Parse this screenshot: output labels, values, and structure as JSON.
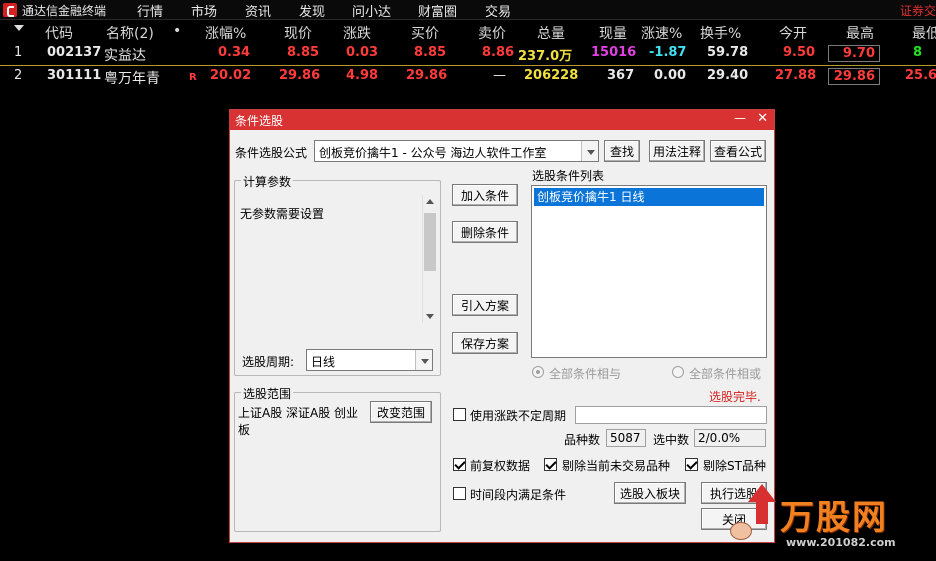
{
  "menubar": {
    "app_name": "通达信金融终端",
    "items": [
      "行情",
      "市场",
      "资讯",
      "发现",
      "问小达",
      "财富圈",
      "交易"
    ],
    "right_tag": "证券交"
  },
  "quote_table": {
    "headers": [
      "代码",
      "名称(2)",
      "涨幅%",
      "现价",
      "涨跌",
      "买价",
      "卖价",
      "总量",
      "现量",
      "涨速%",
      "换手%",
      "今开",
      "最高",
      "最低"
    ],
    "dot": "•",
    "rows": [
      {
        "idx": "1",
        "code": "002137",
        "name": "实益达",
        "flag": "",
        "pct": "0.34",
        "price": "8.85",
        "change": "0.03",
        "bid": "8.85",
        "ask": "8.86",
        "volume": "237.0万",
        "cur_vol": "15016",
        "speed": "-1.87",
        "turnover": "59.78",
        "open": "9.50",
        "high": "9.70",
        "low": "8"
      },
      {
        "idx": "2",
        "code": "301111",
        "name": "粤万年青",
        "flag": "R",
        "pct": "20.02",
        "price": "29.86",
        "change": "4.98",
        "bid": "29.86",
        "ask": "—",
        "volume": "206228",
        "cur_vol": "367",
        "speed": "0.00",
        "turnover": "29.40",
        "open": "27.88",
        "high": "29.86",
        "low": "25.6"
      }
    ]
  },
  "dialog": {
    "title": "条件选股",
    "min_glyph": "—",
    "close_glyph": "✕",
    "formula_label": "条件选股公式",
    "formula_value": "创板竞价擒牛1  -  公众号 海边人软件工作室",
    "btn_find": "查找",
    "btn_usage": "用法注释",
    "btn_view": "查看公式",
    "calc_params_legend": "计算参数",
    "calc_params_text": "无参数需要设置",
    "period_label": "选股周期:",
    "period_value": "日线",
    "range_legend": "选股范围",
    "range_text": "上证A股 深证A股 创业板",
    "btn_change_range": "改变范围",
    "btn_add": "加入条件",
    "btn_delete": "删除条件",
    "btn_import": "引入方案",
    "btn_save": "保存方案",
    "cond_list_label": "选股条件列表",
    "cond_items": [
      "创板竞价擒牛1  日线"
    ],
    "radio_and": "全部条件相与",
    "radio_or": "全部条件相或",
    "status": "选股完毕.",
    "chk_uncertain_period": "使用涨跌不定周期",
    "count_label": "品种数",
    "count_value": "5087",
    "selected_label": "选中数",
    "selected_value": "2/0.0%",
    "chk_prerights": "前复权数据",
    "chk_exclude_untraded": "剔除当前未交易品种",
    "chk_exclude_st": "剔除ST品种",
    "chk_time_range": "时间段内满足条件",
    "btn_to_block": "选股入板块",
    "btn_execute": "执行选股",
    "btn_close": "关闭"
  },
  "watermark": {
    "brand": "万股网",
    "url": "www.201082.com"
  }
}
